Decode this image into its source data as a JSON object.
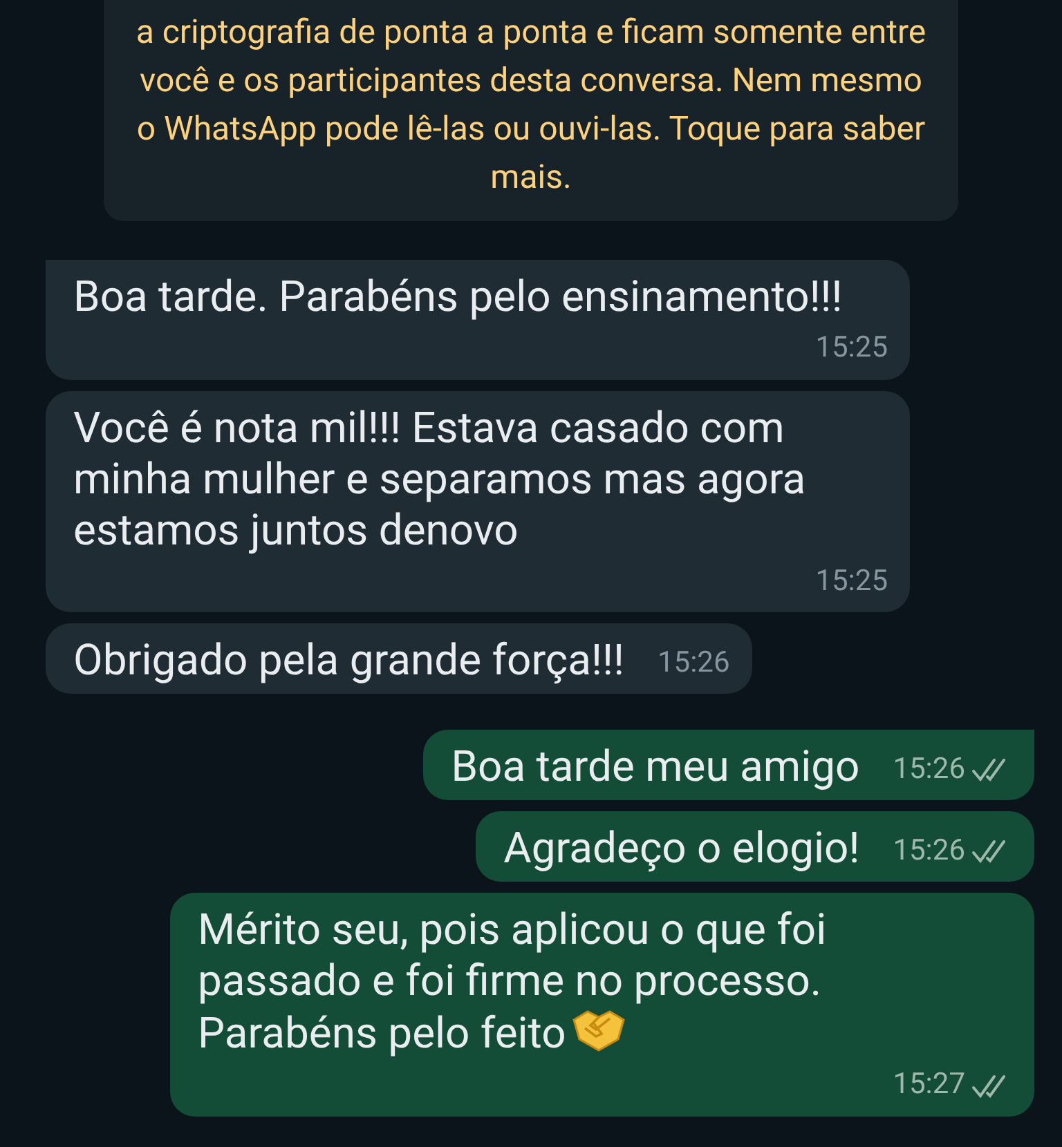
{
  "encryption_notice": {
    "text": "a criptografia de ponta a ponta e ficam somente entre você e os participantes desta conversa. Nem mesmo o WhatsApp pode lê-las ou ouvi-las. Toque para saber mais."
  },
  "messages": [
    {
      "kind": "incoming",
      "text": "Boa tarde. Parabéns pelo ensinamento!!!",
      "time": "15:25",
      "tail": true
    },
    {
      "kind": "incoming",
      "text": "Você é nota mil!!! Estava casado com minha mulher e separamos mas agora estamos juntos denovo",
      "time": "15:25",
      "tail": false
    },
    {
      "kind": "incoming",
      "text": "Obrigado pela grande força!!!",
      "time": "15:26",
      "tail": false
    },
    {
      "kind": "outgoing",
      "text": "Boa tarde meu amigo",
      "time": "15:26",
      "tail": true,
      "read": false
    },
    {
      "kind": "outgoing",
      "text": "Agradeço o elogio!",
      "time": "15:26",
      "tail": false,
      "read": false
    },
    {
      "kind": "outgoing",
      "text": "Mérito seu, pois aplicou o que foi passado e foi firme no processo. Parabéns pelo feito",
      "time": "15:27",
      "tail": false,
      "read": false,
      "handshake_emoji": true
    }
  ]
}
